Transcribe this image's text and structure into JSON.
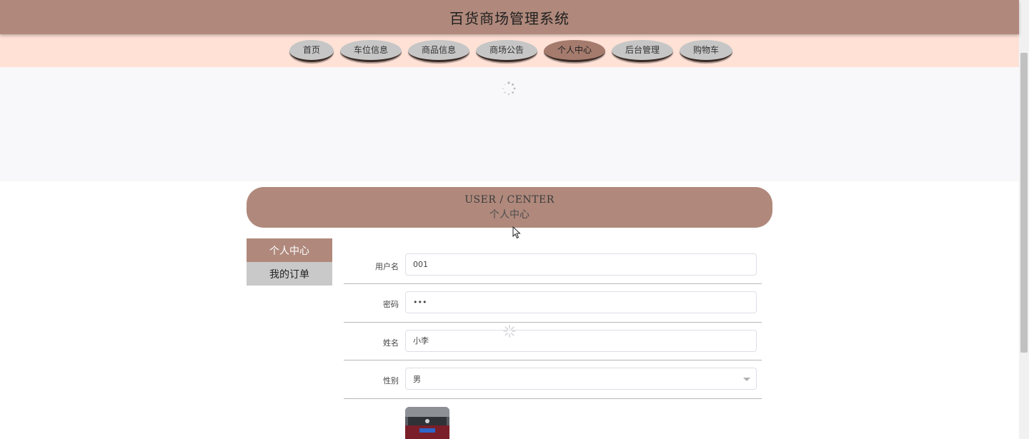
{
  "header": {
    "title": "百货商场管理系统"
  },
  "nav": {
    "items": [
      {
        "label": "首页"
      },
      {
        "label": "车位信息"
      },
      {
        "label": "商品信息"
      },
      {
        "label": "商场公告"
      },
      {
        "label": "个人中心",
        "active": true
      },
      {
        "label": "后台管理"
      },
      {
        "label": "购物车"
      }
    ]
  },
  "center": {
    "title_en": "USER / CENTER",
    "title_cn": "个人中心"
  },
  "sidebar": {
    "items": [
      {
        "label": "个人中心",
        "active": true
      },
      {
        "label": "我的订单"
      }
    ]
  },
  "form": {
    "username": {
      "label": "用户名",
      "value": "001"
    },
    "password": {
      "label": "密码",
      "value": "•••"
    },
    "name": {
      "label": "姓名",
      "value": "小李"
    },
    "gender": {
      "label": "性别",
      "value": "男"
    }
  },
  "colors": {
    "brand": "#b0897c",
    "nav_bg": "#ffe1d6",
    "active_tab": "#a57b6d"
  }
}
